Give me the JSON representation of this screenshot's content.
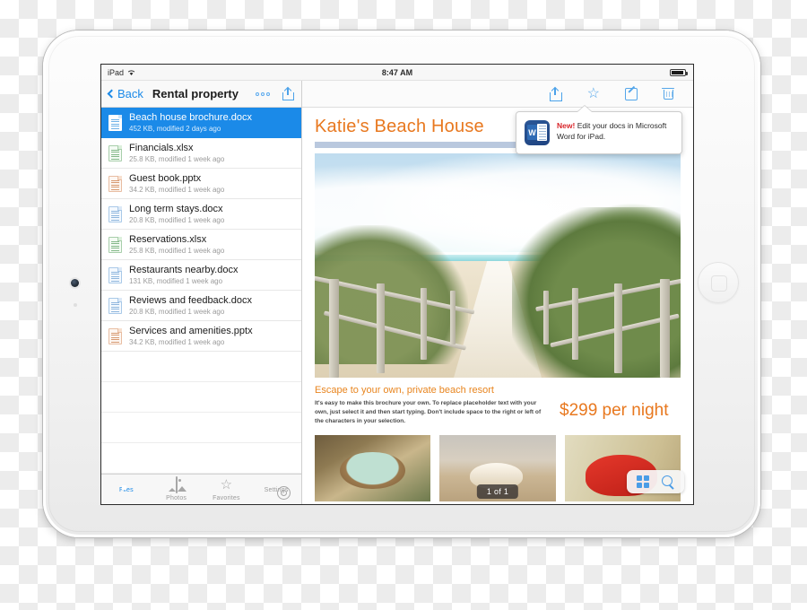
{
  "device": {
    "name": "ipad",
    "orientation": "landscape"
  },
  "statusbar": {
    "carrier": "iPad",
    "wifi_icon": "wifi-icon",
    "time": "8:47 AM",
    "battery_icon": "battery-icon"
  },
  "left_pane": {
    "nav": {
      "back_label": "Back",
      "title": "Rental property",
      "more_icon": "more-dots-icon",
      "share_icon": "share-icon"
    },
    "files": [
      {
        "name": "Beach house brochure.docx",
        "meta": "452 KB, modified 2 days ago",
        "type": "docx",
        "selected": true
      },
      {
        "name": "Financials.xlsx",
        "meta": "25.8 KB, modified 1 week ago",
        "type": "xlsx",
        "selected": false
      },
      {
        "name": "Guest book.pptx",
        "meta": "34.2 KB, modified 1 week ago",
        "type": "pptx",
        "selected": false
      },
      {
        "name": "Long term stays.docx",
        "meta": "20.8 KB, modified 1 week ago",
        "type": "docx",
        "selected": false
      },
      {
        "name": "Reservations.xlsx",
        "meta": "25.8 KB, modified 1 week ago",
        "type": "xlsx",
        "selected": false
      },
      {
        "name": "Restaurants nearby.docx",
        "meta": "131 KB, modified 1 week ago",
        "type": "docx",
        "selected": false
      },
      {
        "name": "Reviews and feedback.docx",
        "meta": "20.8 KB, modified 1 week ago",
        "type": "docx",
        "selected": false
      },
      {
        "name": "Services and amenities.pptx",
        "meta": "34.2 KB, modified 1 week ago",
        "type": "pptx",
        "selected": false
      }
    ],
    "tabs": [
      {
        "label": "Files",
        "icon": "files-icon",
        "active": true
      },
      {
        "label": "Photos",
        "icon": "photos-icon",
        "active": false
      },
      {
        "label": "Favorites",
        "icon": "star-icon",
        "active": false
      },
      {
        "label": "Settings",
        "icon": "gear-icon",
        "active": false
      }
    ]
  },
  "right_pane": {
    "toolbar": [
      {
        "name": "share-icon"
      },
      {
        "name": "star-icon"
      },
      {
        "name": "edit-pencil-icon"
      },
      {
        "name": "trash-icon"
      }
    ],
    "document": {
      "title": "Katie's Beach House",
      "hero_image_alt": "beach path with wooden fence",
      "subheading": "Escape to your own, private beach resort",
      "body": "It's easy to make this brochure your own. To replace placeholder text with your own, just select it and then start typing. Don't include space to the right or left of the characters in your selection.",
      "price": "$299 per night",
      "thumbnails": [
        {
          "alt": "bowl of bath salts"
        },
        {
          "alt": "seashell on sand"
        },
        {
          "alt": "red flip flops"
        }
      ],
      "page_indicator": "1 of 1"
    },
    "float_controls": [
      {
        "name": "grid-view-icon"
      },
      {
        "name": "search-icon"
      }
    ],
    "tooltip": {
      "badge": "New!",
      "message": "Edit your docs in Microsoft Word for iPad.",
      "app_icon": "word-app-icon",
      "word_letter": "W"
    }
  },
  "colors": {
    "accent_blue": "#1b8ae8",
    "toolbar_blue": "#54a6ea",
    "title_orange": "#e8781f",
    "subhead_orange": "#e8851f",
    "tooltip_red": "#d8252a",
    "band_blue": "#b9c8de"
  }
}
